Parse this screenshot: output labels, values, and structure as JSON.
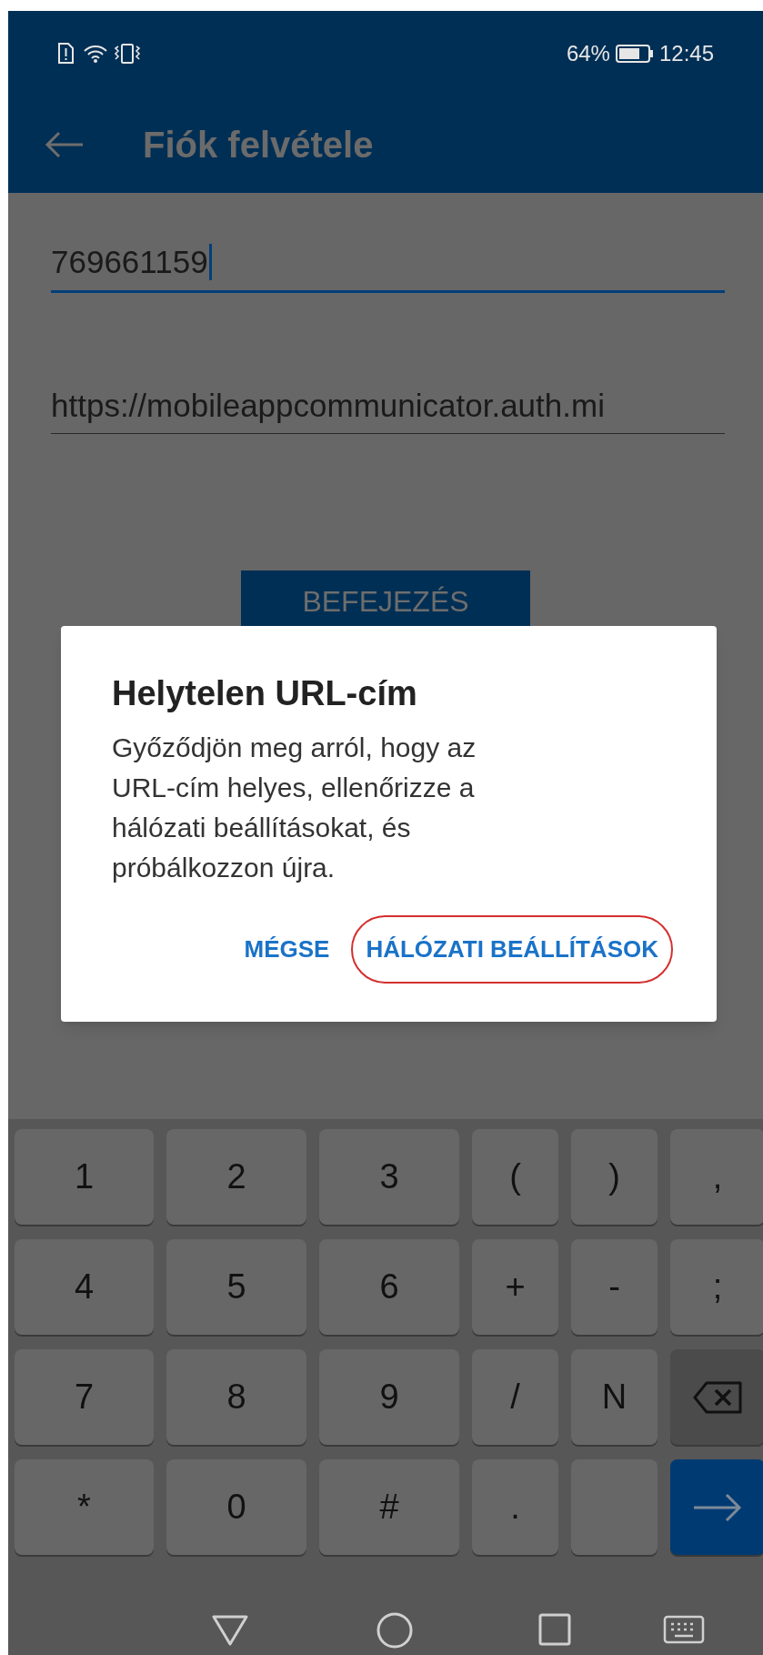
{
  "status_bar": {
    "battery": "64%",
    "time": "12:45"
  },
  "app_bar": {
    "title": "Fiók felvétele"
  },
  "fields": [
    {
      "value": "769661159",
      "focused": true
    },
    {
      "value": "https://mobileappcommunicator.auth.mi",
      "focused": false
    }
  ],
  "submit_button": {
    "label": "BEFEJEZÉS"
  },
  "dialog": {
    "title": "Helytelen URL-cím",
    "message": "Győződjön meg arról, hogy az URL-cím helyes, ellenőrizze a hálózati beállításokat, és próbálkozzon újra.",
    "buttons": [
      {
        "label": "MÉGSE",
        "highlighted": false
      },
      {
        "label": "HÁLÓZATI BEÁLLÍTÁSOK",
        "highlighted": true
      }
    ]
  },
  "keyboard": {
    "rows": [
      [
        {
          "kind": "char",
          "label": "1"
        },
        {
          "kind": "char",
          "label": "2"
        },
        {
          "kind": "char",
          "label": "3"
        },
        {
          "kind": "char",
          "label": "("
        },
        {
          "kind": "char",
          "label": ")"
        },
        {
          "kind": "char",
          "label": ","
        }
      ],
      [
        {
          "kind": "char",
          "label": "4"
        },
        {
          "kind": "char",
          "label": "5"
        },
        {
          "kind": "char",
          "label": "6"
        },
        {
          "kind": "char",
          "label": "+"
        },
        {
          "kind": "char",
          "label": "-"
        },
        {
          "kind": "char",
          "label": ";"
        }
      ],
      [
        {
          "kind": "char",
          "label": "7"
        },
        {
          "kind": "char",
          "label": "8"
        },
        {
          "kind": "char",
          "label": "9"
        },
        {
          "kind": "char",
          "label": "/"
        },
        {
          "kind": "char",
          "label": "N"
        },
        {
          "kind": "backspace"
        }
      ],
      [
        {
          "kind": "char",
          "label": "*"
        },
        {
          "kind": "char",
          "label": "0"
        },
        {
          "kind": "char",
          "label": "#"
        },
        {
          "kind": "char",
          "label": "."
        },
        {
          "kind": "blank"
        },
        {
          "kind": "enter"
        }
      ]
    ]
  }
}
